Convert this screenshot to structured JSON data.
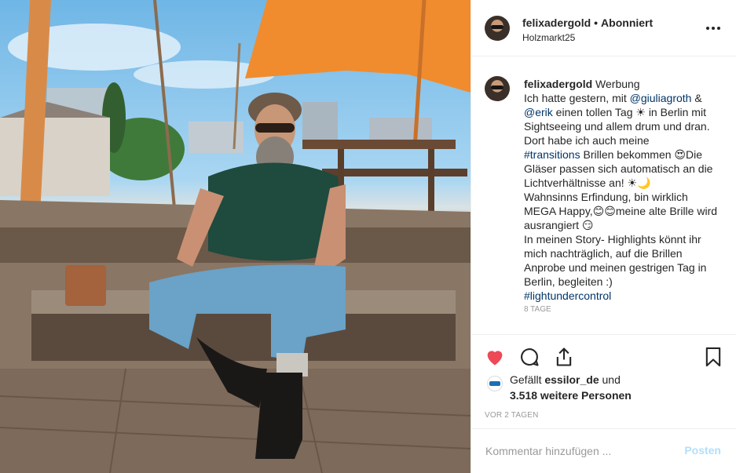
{
  "header": {
    "username": "felixadergold",
    "separator": "•",
    "follow_status": "Abonniert",
    "location": "Holzmarkt25"
  },
  "caption": {
    "username": "felixadergold",
    "sponsor_tag": "Werbung",
    "seg1": "Ich hatte gestern, mit ",
    "mention1": "@giuliagroth",
    "seg2": " & ",
    "mention2": "@erik",
    "seg3": " einen tollen Tag ☀ in Berlin mit Sightseeing und allem drum und dran.",
    "seg4": "Dort habe ich auch meine ",
    "hashtag1": "#transitions",
    "seg5": " Brillen bekommen 😍Die Gläser passen sich automatisch an die Lichtverhältnisse an! ☀🌙",
    "seg6": "Wahnsinns Erfindung, bin wirklich MEGA Happy,😊😊meine alte Brille wird ausrangiert 😏",
    "seg7": "In meinen Story- Highlights könnt ihr mich nachträglich, auf die Brillen Anprobe und meinen gestrigen Tag in Berlin, begleiten :)",
    "hashtag2": "#lightundercontrol",
    "time_ago": "8 Tage"
  },
  "actions": {
    "like_icon": "heart-icon",
    "comment_icon": "comment-icon",
    "share_icon": "share-icon",
    "save_icon": "bookmark-icon",
    "like_color": "#ed4956"
  },
  "likes": {
    "prefix": "Gefällt ",
    "first_liker": "essilor_de",
    "suffix": " und",
    "others": "3.518 weitere Personen"
  },
  "post_date": "VOR 2 TAGEN",
  "comment_box": {
    "placeholder": "Kommentar hinzufügen ...",
    "post_label": "Posten"
  },
  "colors": {
    "link": "#003569",
    "post_disabled": "#b2dffc",
    "umbrella": "#f08c2e"
  }
}
